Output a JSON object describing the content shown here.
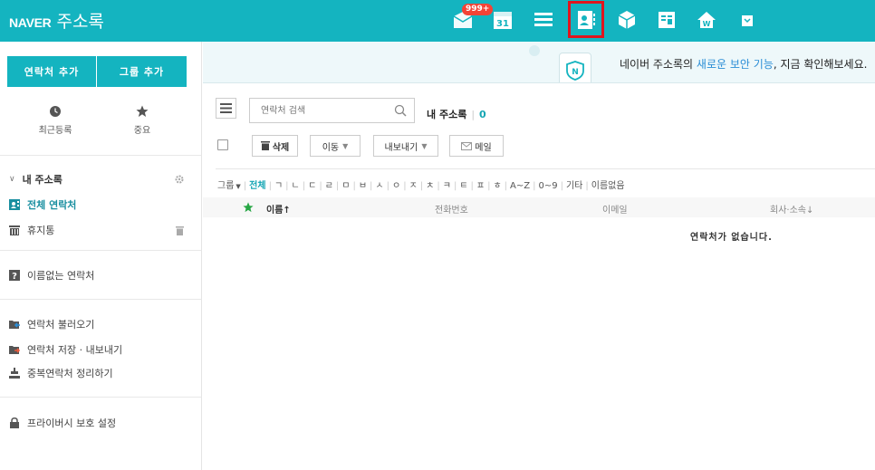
{
  "header": {
    "brand": "NAVER",
    "app_name": "주소록",
    "mail_badge": "999+",
    "calendar_day": "31",
    "icons": [
      "mail-icon",
      "calendar-icon",
      "list-icon",
      "contacts-icon",
      "cube-icon",
      "memo-icon",
      "home-icon",
      "more-icon"
    ],
    "accent": "#14b4c0",
    "highlight_color": "#e0151e"
  },
  "sidebar": {
    "add_contact": "연락처 추가",
    "add_group": "그룹 추가",
    "recent": "최근등록",
    "starred": "중요",
    "my_addressbook": "내 주소록",
    "all_contacts": "전체 연락처",
    "trash": "휴지통",
    "unnamed": "이름없는 연락처",
    "import": "연락처 불러오기",
    "export": "연락처 저장 · 내보내기",
    "dedupe": "중복연락처 정리하기",
    "privacy": "프라이버시 보호 설정"
  },
  "banner": {
    "prefix": "네이버 주소록의 ",
    "highlight": "새로운 보안 기능",
    "suffix": ", 지금 확인해보세요."
  },
  "toolbar": {
    "search_placeholder": "연락처 검색",
    "addressbook_label": "내 주소록",
    "count": "0",
    "delete": "삭제",
    "move": "이동",
    "export": "내보내기",
    "mail": "메일"
  },
  "filter": {
    "group": "그룹",
    "all": "전체",
    "letters": [
      "ㄱ",
      "ㄴ",
      "ㄷ",
      "ㄹ",
      "ㅁ",
      "ㅂ",
      "ㅅ",
      "ㅇ",
      "ㅈ",
      "ㅊ",
      "ㅋ",
      "ㅌ",
      "ㅍ",
      "ㅎ",
      "A~Z",
      "0~9",
      "기타",
      "이름없음"
    ]
  },
  "table": {
    "col_name": "이름↑",
    "col_phone": "전화번호",
    "col_email": "이메일",
    "col_company": "회사·소속↓",
    "empty_message": "연락처가 없습니다."
  }
}
